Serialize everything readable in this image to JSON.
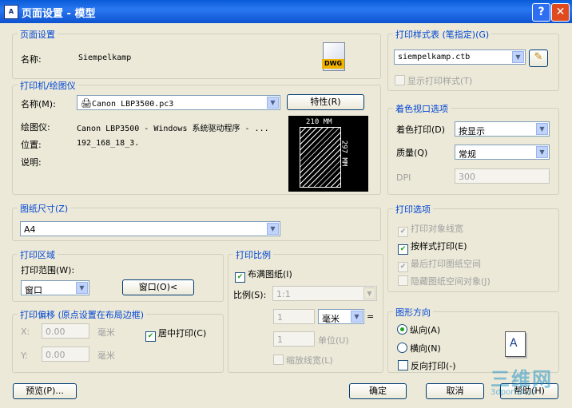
{
  "window": {
    "title": "页面设置 - 模型",
    "icon_text": "A▌",
    "help": "?",
    "close": "✕"
  },
  "page_setup": {
    "legend": "页面设置",
    "name_label": "名称:",
    "name_value": "Siempelkamp",
    "badge": "DWG"
  },
  "printer": {
    "legend": "打印机/绘图仪",
    "name_label": "名称(M):",
    "name_value": "Canon LBP3500.pc3",
    "properties_button": "特性(R)",
    "plotter_label": "绘图仪:",
    "plotter_value": "Canon LBP3500 - Windows 系统驱动程序 - ...",
    "location_label": "位置:",
    "location_value": "192_168_18_3.",
    "desc_label": "说明:",
    "preview_width": "210 MM",
    "preview_height": "297 MM"
  },
  "paper": {
    "legend": "图纸尺寸(Z)",
    "value": "A4"
  },
  "plot_area": {
    "legend": "打印区域",
    "range_label": "打印范围(W):",
    "range_value": "窗口",
    "window_button": "窗口(O)<"
  },
  "plot_offset": {
    "legend": "打印偏移 (原点设置在布局边框)",
    "x_label": "X:",
    "x_value": "0.00",
    "x_unit": "毫米",
    "y_label": "Y:",
    "y_value": "0.00",
    "y_unit": "毫米",
    "center_label": "居中打印(C)"
  },
  "plot_scale": {
    "legend": "打印比例",
    "fit_label": "布满图纸(I)",
    "scale_label": "比例(S):",
    "scale_value": "1:1",
    "val1": "1",
    "unit_value": "毫米",
    "eq": "=",
    "val2": "1",
    "unit2": "单位(U)",
    "lineweights_label": "缩放线宽(L)"
  },
  "style_table": {
    "legend": "打印样式表 (笔指定)(G)",
    "value": "siempelkamp.ctb",
    "show_label": "显示打印样式(T)"
  },
  "shaded": {
    "legend": "着色视口选项",
    "shade_label": "着色打印(D)",
    "shade_value": "按显示",
    "quality_label": "质量(Q)",
    "quality_value": "常规",
    "dpi_label": "DPI",
    "dpi_value": "300"
  },
  "options": {
    "legend": "打印选项",
    "opt1": "打印对象线宽",
    "opt2": "按样式打印(E)",
    "opt3": "最后打印图纸空间",
    "opt4": "隐藏图纸空间对象(J)"
  },
  "orientation": {
    "legend": "图形方向",
    "portrait": "纵向(A)",
    "landscape": "横向(N)",
    "upside": "反向打印(-)",
    "icon_letter": "A"
  },
  "buttons": {
    "preview": "预览(P)...",
    "ok": "确定",
    "cancel": "取消",
    "help": "帮助(H)"
  },
  "watermark": {
    "text": "三维网",
    "sub": "3dportal.cn"
  }
}
